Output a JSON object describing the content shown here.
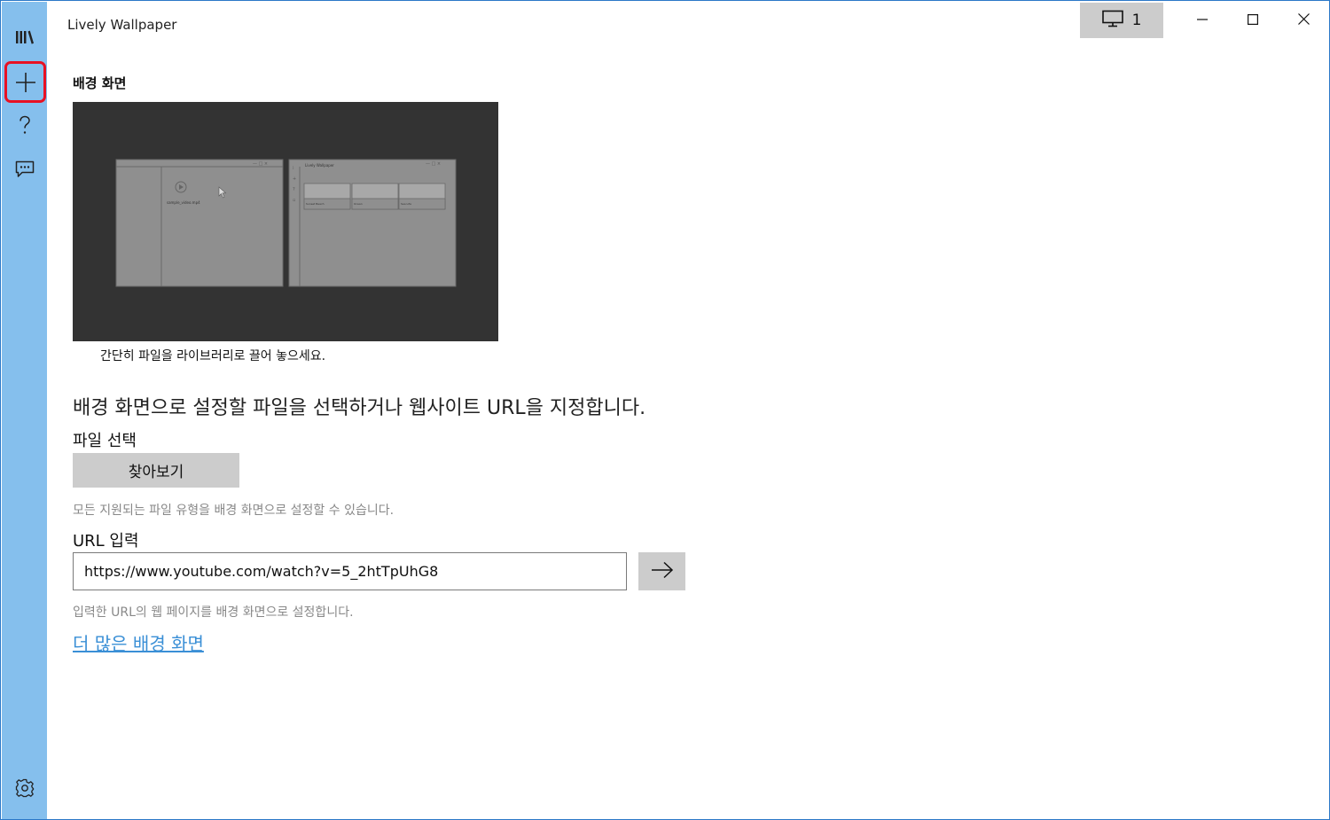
{
  "app": {
    "title": "Lively Wallpaper"
  },
  "titlebar": {
    "monitor_label": "1"
  },
  "sidebar": {
    "items": [
      {
        "name": "library",
        "icon": "library-icon"
      },
      {
        "name": "add",
        "icon": "plus-icon",
        "selected": true
      },
      {
        "name": "help",
        "icon": "question-icon"
      },
      {
        "name": "feedback",
        "icon": "feedback-icon"
      }
    ],
    "settings_icon": "gear-icon"
  },
  "page": {
    "section_title": "배경 화면",
    "preview": {
      "window_title": "Lively Wallpaper",
      "file_name": "sample_video.mp4",
      "tiles": [
        "Sunset Beach",
        "Ocean",
        "Sea Life"
      ]
    },
    "caption": "간단히 파일을 라이브러리로 끌어 놓으세요.",
    "description": "배경 화면으로 설정할 파일을 선택하거나 웹사이트 URL을 지정합니다.",
    "file_select_label": "파일 선택",
    "browse_button": "찾아보기",
    "file_hint": "모든 지원되는 파일 유형을 배경 화면으로 설정할 수 있습니다.",
    "url_label": "URL 입력",
    "url_value": "https://www.youtube.com/watch?v=5_2htTpUhG8",
    "url_hint": "입력한 URL의 웹 페이지를 배경 화면으로 설정합니다.",
    "more_link": "더 많은 배경 화면"
  },
  "colors": {
    "sidebar": "#85bfed",
    "accent": "#3a8fd6",
    "selection_border": "#e81123",
    "button": "#cccccc",
    "preview_bg": "#333333"
  }
}
